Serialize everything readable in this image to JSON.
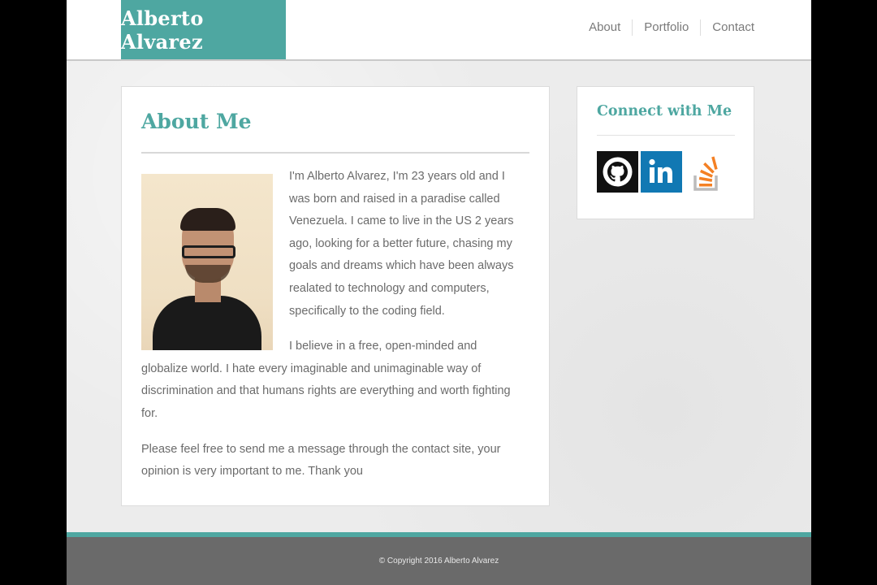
{
  "header": {
    "logo_text": "Alberto Alvarez",
    "nav": [
      "About",
      "Portfolio",
      "Contact"
    ]
  },
  "about": {
    "title": "About Me",
    "paragraphs": [
      "I'm Alberto Alvarez, I'm 23 years old and I was born and raised in a paradise called Venezuela. I came to live in the US 2 years ago, looking for a better future, chasing my goals and dreams which have been always realated to technology and computers, specifically to the coding field.",
      "I believe in a free, open-minded and globalize world. I hate every imaginable and unimaginable way of discrimination and that humans rights are everything and worth fighting for.",
      "Please feel free to send me a message through the contact site, your opinion is very important to me. Thank you"
    ]
  },
  "sidebar": {
    "title": "Connect with Me",
    "social_icons": [
      "github-icon",
      "linkedin-icon",
      "stackoverflow-icon"
    ]
  },
  "footer": {
    "copyright": "© Copyright 2016 Alberto Alvarez"
  },
  "colors": {
    "accent": "#4ea7a1",
    "footer_bg": "#6a6a6a",
    "linkedin": "#1178b3",
    "stackoverflow": "#f48024"
  }
}
